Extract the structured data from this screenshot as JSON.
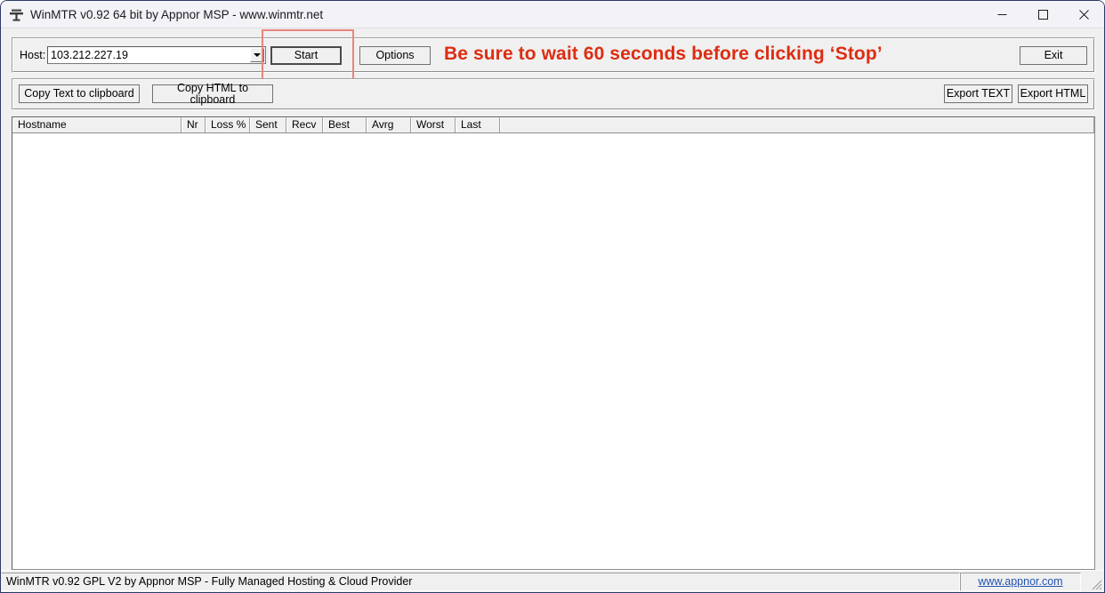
{
  "window": {
    "title": "WinMTR v0.92 64 bit by Appnor MSP - www.winmtr.net",
    "icon": "winmtr-app-icon",
    "controls": {
      "minimize": "minimize-icon",
      "maximize": "maximize-icon",
      "close": "close-icon"
    }
  },
  "toolbar": {
    "host_label": "Host:",
    "host_value": "103.212.227.19",
    "host_placeholder": "",
    "dropdown_icon": "chevron-down-icon",
    "start_label": "Start",
    "options_label": "Options",
    "exit_label": "Exit",
    "copy_text_label": "Copy Text to clipboard",
    "copy_html_label": "Copy HTML to clipboard",
    "export_text_label": "Export TEXT",
    "export_html_label": "Export HTML"
  },
  "annotation": {
    "text": "Be sure to wait 60 seconds before clicking ‘Stop’",
    "text_color": "#dd2d12",
    "box_color": "#e8857c"
  },
  "table": {
    "columns": [
      {
        "label": "Hostname",
        "width": 190
      },
      {
        "label": "Nr",
        "width": 27
      },
      {
        "label": "Loss %",
        "width": 50
      },
      {
        "label": "Sent",
        "width": 41
      },
      {
        "label": "Recv",
        "width": 41
      },
      {
        "label": "Best",
        "width": 49
      },
      {
        "label": "Avrg",
        "width": 50
      },
      {
        "label": "Worst",
        "width": 50
      },
      {
        "label": "Last",
        "width": 50
      }
    ],
    "rows": []
  },
  "statusbar": {
    "message": "WinMTR v0.92 GPL V2 by Appnor MSP - Fully Managed Hosting & Cloud Provider",
    "link_text": "www.appnor.com",
    "grip_icon": "resize-grip-icon"
  }
}
